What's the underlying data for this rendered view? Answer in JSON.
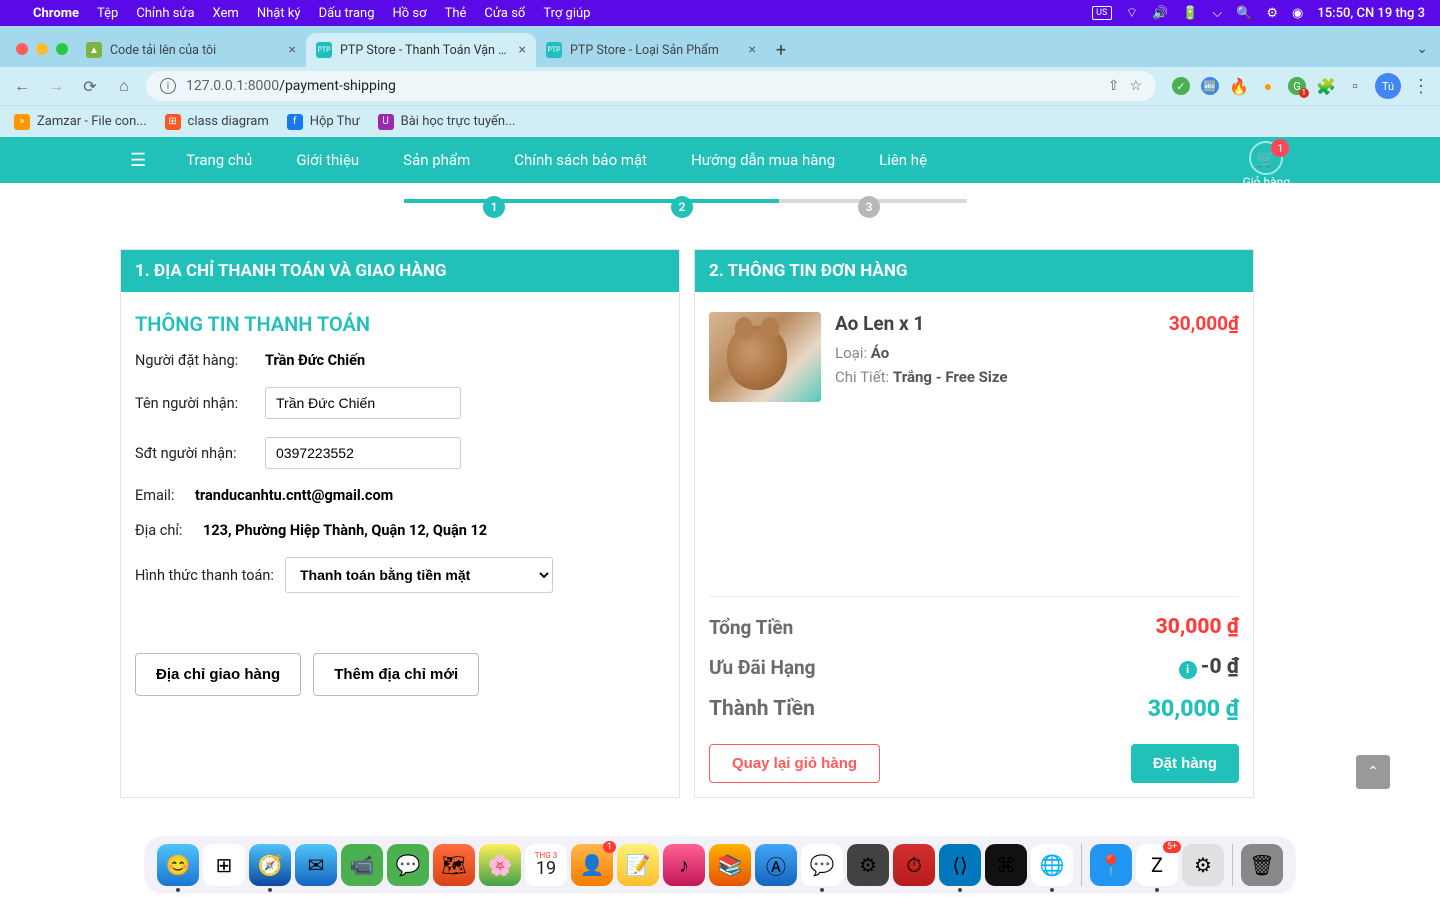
{
  "menubar": {
    "app": "Chrome",
    "items": [
      "Tệp",
      "Chỉnh sửa",
      "Xem",
      "Nhật ký",
      "Dấu trang",
      "Hồ sơ",
      "Thẻ",
      "Cửa sổ",
      "Trợ giúp"
    ],
    "input_method": "US",
    "clock": "15:50, CN 19 thg 3"
  },
  "tabs": [
    {
      "title": "Code tải lên của tôi",
      "active": false,
      "fav_bg": "#7cb342",
      "fav_text": "▲"
    },
    {
      "title": "PTP Store - Thanh Toán Vận Ch",
      "active": true,
      "fav_bg": "#1fbec0",
      "fav_text": "PTP"
    },
    {
      "title": "PTP Store - Loại Sản Phẩm",
      "active": false,
      "fav_bg": "#1fbec0",
      "fav_text": "PTP"
    }
  ],
  "url": {
    "host": "127.0.0.1",
    "port": ":8000",
    "path": "/payment-shipping"
  },
  "bookmarks": [
    {
      "label": "Zamzar - File con...",
      "bg": "#ff9800",
      "txt": "»"
    },
    {
      "label": "class diagram",
      "bg": "#ff5722",
      "txt": "⊞"
    },
    {
      "label": "Hộp Thư",
      "bg": "#1877f2",
      "txt": "f"
    },
    {
      "label": "Bài học trực tuyến...",
      "bg": "#9c27b0",
      "txt": "U"
    }
  ],
  "nav": {
    "links": [
      "Trang chủ",
      "Giới thiệu",
      "Sản phẩm",
      "Chính sách bảo mật",
      "Hướng dẫn mua hàng",
      "Liên hệ"
    ],
    "cart_label": "Giỏ hàng",
    "cart_count": "1"
  },
  "steps": {
    "s1": "1",
    "s2": "2",
    "s3": "3"
  },
  "panel1": {
    "title": "1. ĐỊA CHỈ THANH TOÁN VÀ GIAO HÀNG",
    "subtitle": "THÔNG TIN THANH TOÁN",
    "orderer_label": "Người đặt hàng:",
    "orderer_name": "Trần Đức Chiến",
    "recipient_label": "Tên người nhận:",
    "recipient_value": "Trần Đức Chiến",
    "phone_label": "Sđt người nhận:",
    "phone_value": "0397223552",
    "email_label": "Email:",
    "email_value": "tranducanhtu.cntt@gmail.com",
    "address_label": "Địa chỉ:",
    "address_value": "123, Phường Hiệp Thành, Quận 12, Quận 12",
    "payment_label": "Hình thức thanh toán:",
    "payment_value": "Thanh toán bằng tiền mặt",
    "btn_ship": "Địa chỉ giao hàng",
    "btn_add": "Thêm địa chỉ mới"
  },
  "panel2": {
    "title": "2. THÔNG TIN ĐƠN HÀNG",
    "item": {
      "name": "Ao Len x 1",
      "type_label": "Loại: ",
      "type_value": "Áo",
      "detail_label": "Chi Tiết: ",
      "detail_value": "Trắng - Free Size",
      "price": "30,000₫"
    },
    "total_label": "Tổng Tiền",
    "total_value": "30,000 ₫",
    "discount_label": "Ưu Đãi Hạng",
    "discount_value": "-0 ₫",
    "final_label": "Thành Tiền",
    "final_value": "30,000 ₫",
    "btn_back": "Quay lại giỏ hàng",
    "btn_order": "Đặt hàng"
  }
}
